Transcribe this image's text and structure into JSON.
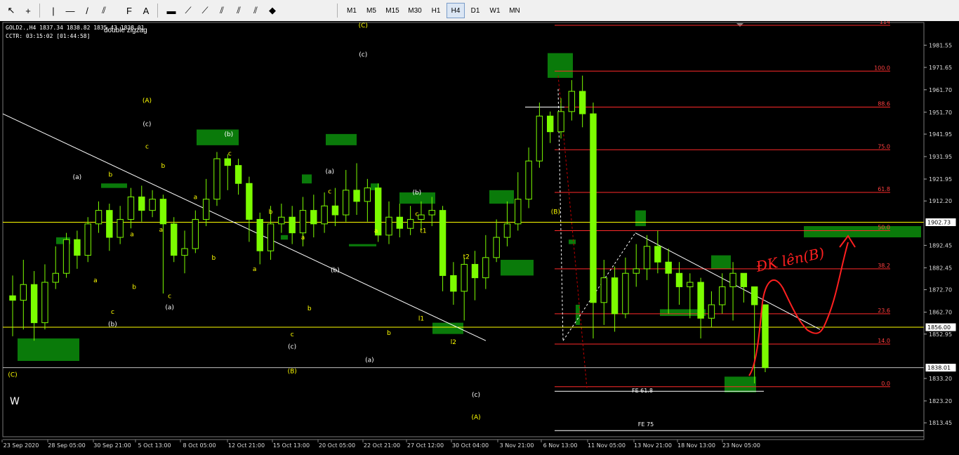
{
  "toolbar": {
    "timeframes": [
      "M1",
      "M5",
      "M15",
      "M30",
      "H1",
      "H4",
      "D1",
      "W1",
      "MN"
    ],
    "active_timeframe": "H4",
    "tools": [
      {
        "name": "cursor-icon",
        "glyph": "↖"
      },
      {
        "name": "crosshair-icon",
        "glyph": "+"
      },
      {
        "name": "vertical-line-icon",
        "glyph": "|"
      },
      {
        "name": "horizontal-line-icon",
        "glyph": "—"
      },
      {
        "name": "trendline-icon",
        "glyph": "/"
      },
      {
        "name": "equidistant-channel-icon",
        "glyph": "⫽"
      },
      {
        "name": "fibonacci-icon",
        "glyph": "F"
      },
      {
        "name": "text-icon",
        "glyph": "A"
      },
      {
        "name": "rectangle-icon",
        "glyph": "▬"
      },
      {
        "name": "fibo-fan-icon",
        "glyph": "⟋"
      },
      {
        "name": "fibo-arcs-icon",
        "glyph": "⟋"
      },
      {
        "name": "fibo-time-icon",
        "glyph": "⫽"
      },
      {
        "name": "gann-icon",
        "glyph": "⫽"
      },
      {
        "name": "pitchfork-icon",
        "glyph": "⫽"
      },
      {
        "name": "arrow-shapes-icon",
        "glyph": "◆"
      }
    ]
  },
  "chart_info": {
    "symbol_line": "GOLD2.,H4  1837.34 1838.82 1835.43 1838.01",
    "cctr_line": "CCTR: 03:15:02 [01:44:58]",
    "subtitle": "double zigzag",
    "wave_label_w": "W",
    "annotation_handwritten": "ĐK lên(B)"
  },
  "chart_data": {
    "type": "candlestick",
    "symbol": "GOLD2.",
    "timeframe": "H4",
    "ylim": [
      1808.5,
      1990.4
    ],
    "y_ticks": [
      1981.55,
      1971.65,
      1961.7,
      1951.7,
      1941.95,
      1931.95,
      1921.95,
      1912.2,
      1902.73,
      1892.45,
      1882.45,
      1872.7,
      1862.7,
      1856.0,
      1852.95,
      1838.01,
      1833.2,
      1823.2,
      1813.45
    ],
    "price_labels": [
      {
        "value": 1902.73,
        "text": "1902.73",
        "highlight": true
      },
      {
        "value": 1856.0,
        "text": "1856.00",
        "highlight": true
      },
      {
        "value": 1838.01,
        "text": "1838.01",
        "highlight": true
      }
    ],
    "x_labels": [
      "23 Sep 2020",
      "28 Sep 05:00",
      "30 Sep 21:00",
      "5 Oct 13:00",
      "8 Oct 05:00",
      "12 Oct 21:00",
      "15 Oct 13:00",
      "20 Oct 05:00",
      "22 Oct 21:00",
      "27 Oct 12:00",
      "30 Oct 04:00",
      "3 Nov 21:00",
      "6 Nov 13:00",
      "11 Nov 05:00",
      "13 Nov 21:00",
      "18 Nov 13:00",
      "23 Nov 05:00"
    ],
    "horizontal_lines": [
      {
        "value": 1902.73,
        "color": "#ffff00"
      },
      {
        "value": 1856.0,
        "color": "#ffff00"
      },
      {
        "value": 1838.01,
        "color": "#c0c0c0"
      }
    ],
    "fibonacci_levels": [
      {
        "label": "114",
        "value": 1990.4
      },
      {
        "label": "100.0",
        "value": 1970.0
      },
      {
        "label": "88.6",
        "value": 1954.0
      },
      {
        "label": "75.0",
        "value": 1935.0
      },
      {
        "label": "61.8",
        "value": 1916.0
      },
      {
        "label": "50.0",
        "value": 1899.0
      },
      {
        "label": "38.2",
        "value": 1882.0
      },
      {
        "label": "23.6",
        "value": 1862.0
      },
      {
        "label": "14.0",
        "value": 1848.5
      },
      {
        "label": "0.0",
        "value": 1829.5
      }
    ],
    "fibo_expansion_labels": [
      {
        "label": "FE 61.8",
        "value": 1827.5
      },
      {
        "label": "FE 75",
        "value": 1812.0
      }
    ],
    "wave_labels": [
      {
        "text": "(C)",
        "x": 0,
        "value": 1834.0,
        "color": "#ffff00"
      },
      {
        "text": "(a)",
        "x": 6.0,
        "value": 1922.0,
        "color": "#ffffff"
      },
      {
        "text": "b",
        "x": 9.1,
        "value": 1923.0,
        "color": "#ffff00"
      },
      {
        "text": "a",
        "x": 7.7,
        "value": 1876.0,
        "color": "#ffff00"
      },
      {
        "text": "c",
        "x": 9.3,
        "value": 1862.0,
        "color": "#ffff00"
      },
      {
        "text": "(b)",
        "x": 9.3,
        "value": 1856.5,
        "color": "#ffffff"
      },
      {
        "text": "b",
        "x": 11.3,
        "value": 1873.0,
        "color": "#ffff00"
      },
      {
        "text": "a",
        "x": 11.1,
        "value": 1896.5,
        "color": "#ffff00"
      },
      {
        "text": "(A)",
        "x": 12.5,
        "value": 1956.0,
        "color": "#ffff00"
      },
      {
        "text": "(c)",
        "x": 12.5,
        "value": 1945.5,
        "color": "#ffffff"
      },
      {
        "text": "c",
        "x": 12.5,
        "value": 1935.5,
        "color": "#ffff00"
      },
      {
        "text": "b",
        "x": 14.0,
        "value": 1927.0,
        "color": "#ffff00"
      },
      {
        "text": "a",
        "x": 13.8,
        "value": 1898.5,
        "color": "#ffff00"
      },
      {
        "text": "c",
        "x": 14.6,
        "value": 1869.0,
        "color": "#ffff00"
      },
      {
        "text": "(a)",
        "x": 14.6,
        "value": 1864.0,
        "color": "#ffffff"
      },
      {
        "text": "a",
        "x": 17.0,
        "value": 1913.0,
        "color": "#ffff00"
      },
      {
        "text": "b",
        "x": 18.7,
        "value": 1886.0,
        "color": "#ffff00"
      },
      {
        "text": "(b)",
        "x": 20.1,
        "value": 1941.0,
        "color": "#ffffff"
      },
      {
        "text": "c",
        "x": 20.2,
        "value": 1932.5,
        "color": "#ffff00"
      },
      {
        "text": "a",
        "x": 22.5,
        "value": 1881.0,
        "color": "#ffff00"
      },
      {
        "text": "b",
        "x": 24.0,
        "value": 1906.5,
        "color": "#ffff00"
      },
      {
        "text": "c",
        "x": 26.0,
        "value": 1852.0,
        "color": "#ffff00"
      },
      {
        "text": "(c)",
        "x": 26.0,
        "value": 1846.5,
        "color": "#ffffff"
      },
      {
        "text": "(B)",
        "x": 26.0,
        "value": 1835.5,
        "color": "#ffff00"
      },
      {
        "text": "a",
        "x": 27.0,
        "value": 1895.0,
        "color": "#ffff00"
      },
      {
        "text": "b",
        "x": 27.6,
        "value": 1863.5,
        "color": "#ffff00"
      },
      {
        "text": "(a)",
        "x": 29.5,
        "value": 1924.5,
        "color": "#ffffff"
      },
      {
        "text": "c",
        "x": 29.5,
        "value": 1915.5,
        "color": "#ffff00"
      },
      {
        "text": "(b)",
        "x": 30.0,
        "value": 1880.5,
        "color": "#ffffff"
      },
      {
        "text": "(C)",
        "x": 32.6,
        "value": 1989.5,
        "color": "#ffff00"
      },
      {
        "text": "(c)",
        "x": 32.6,
        "value": 1976.5,
        "color": "#ffffff"
      },
      {
        "text": "a",
        "x": 33.8,
        "value": 1898.0,
        "color": "#ffff00"
      },
      {
        "text": "b",
        "x": 35.0,
        "value": 1852.5,
        "color": "#ffff00"
      },
      {
        "text": "(a)",
        "x": 33.2,
        "value": 1840.5,
        "color": "#ffffff"
      },
      {
        "text": "(b)",
        "x": 37.6,
        "value": 1915.0,
        "color": "#ffffff"
      },
      {
        "text": "c",
        "x": 37.6,
        "value": 1905.5,
        "color": "#ffff00"
      },
      {
        "text": "t1",
        "x": 38.2,
        "value": 1898.0,
        "color": "#ffff00"
      },
      {
        "text": "l1",
        "x": 38.0,
        "value": 1859.0,
        "color": "#ffff00"
      },
      {
        "text": "t2",
        "x": 42.2,
        "value": 1886.5,
        "color": "#ffff00"
      },
      {
        "text": "l2",
        "x": 41.0,
        "value": 1848.5,
        "color": "#ffff00"
      },
      {
        "text": "(c)",
        "x": 43.1,
        "value": 1825.0,
        "color": "#ffffff"
      },
      {
        "text": "(A)",
        "x": 43.1,
        "value": 1815.0,
        "color": "#ffff00"
      },
      {
        "text": "(B)",
        "x": 50.5,
        "value": 1906.5,
        "color": "#ffff00"
      }
    ],
    "series": [
      {
        "name": "",
        "values": [
          [
            0,
            1870,
            1868,
            1879,
            1852
          ],
          [
            1,
            1868,
            1875,
            1886,
            1855
          ],
          [
            2,
            1875,
            1858,
            1881,
            1850
          ],
          [
            3,
            1858,
            1876,
            1884,
            1855
          ],
          [
            4,
            1876,
            1880,
            1892,
            1873
          ],
          [
            5,
            1880,
            1895,
            1898,
            1878
          ],
          [
            6,
            1895,
            1888,
            1899,
            1882
          ],
          [
            7,
            1888,
            1902,
            1905,
            1885
          ],
          [
            8,
            1902,
            1908,
            1912,
            1898
          ],
          [
            9,
            1908,
            1896,
            1911,
            1890
          ],
          [
            10,
            1896,
            1904,
            1910,
            1893
          ],
          [
            11,
            1904,
            1914,
            1918,
            1900
          ],
          [
            12,
            1914,
            1908,
            1919,
            1903
          ],
          [
            13,
            1908,
            1913,
            1917,
            1905
          ],
          [
            14,
            1913,
            1902,
            1915,
            1871
          ],
          [
            15,
            1902,
            1888,
            1905,
            1885
          ],
          [
            16,
            1888,
            1891,
            1899,
            1880
          ],
          [
            17,
            1891,
            1904,
            1908,
            1889
          ],
          [
            18,
            1904,
            1913,
            1922,
            1901
          ],
          [
            19,
            1913,
            1931,
            1934,
            1910
          ],
          [
            20,
            1931,
            1928,
            1933,
            1917
          ],
          [
            21,
            1928,
            1920,
            1931,
            1915
          ],
          [
            22,
            1920,
            1904,
            1923,
            1894
          ],
          [
            23,
            1904,
            1890,
            1907,
            1884
          ],
          [
            24,
            1890,
            1902,
            1910,
            1886
          ],
          [
            25,
            1902,
            1905,
            1911,
            1898
          ],
          [
            26,
            1905,
            1898,
            1910,
            1893
          ],
          [
            27,
            1898,
            1908,
            1914,
            1892
          ],
          [
            28,
            1908,
            1902,
            1915,
            1896
          ],
          [
            29,
            1902,
            1910,
            1916,
            1898
          ],
          [
            30,
            1910,
            1906,
            1918,
            1901
          ],
          [
            31,
            1906,
            1917,
            1926,
            1903
          ],
          [
            32,
            1917,
            1912,
            1929,
            1906
          ],
          [
            33,
            1912,
            1918,
            1922,
            1903
          ],
          [
            34,
            1918,
            1897,
            1920,
            1894
          ],
          [
            35,
            1897,
            1905,
            1912,
            1893
          ],
          [
            36,
            1905,
            1900,
            1911,
            1896
          ],
          [
            37,
            1900,
            1904,
            1910,
            1897
          ],
          [
            38,
            1904,
            1906,
            1912,
            1899
          ],
          [
            39,
            1906,
            1908,
            1914,
            1901
          ],
          [
            40,
            1908,
            1879,
            1910,
            1872
          ],
          [
            41,
            1879,
            1872,
            1885,
            1866
          ],
          [
            42,
            1872,
            1884,
            1887,
            1859
          ],
          [
            43,
            1884,
            1878,
            1890,
            1868
          ],
          [
            44,
            1878,
            1887,
            1897,
            1873
          ],
          [
            45,
            1887,
            1896,
            1904,
            1885
          ],
          [
            46,
            1896,
            1902,
            1912,
            1892
          ],
          [
            47,
            1902,
            1913,
            1925,
            1899
          ],
          [
            48,
            1913,
            1930,
            1936,
            1909
          ],
          [
            49,
            1930,
            1950,
            1956,
            1927
          ],
          [
            50,
            1950,
            1943,
            1952,
            1938
          ],
          [
            51,
            1943,
            1952,
            1958,
            1940
          ],
          [
            52,
            1952,
            1961,
            1966,
            1948
          ],
          [
            53,
            1961,
            1951,
            1968,
            1945
          ],
          [
            54,
            1951,
            1867,
            1956,
            1851
          ],
          [
            55,
            1867,
            1878,
            1886,
            1857
          ],
          [
            56,
            1878,
            1862,
            1883,
            1854
          ],
          [
            57,
            1862,
            1880,
            1887,
            1860
          ],
          [
            58,
            1880,
            1882,
            1893,
            1874
          ],
          [
            59,
            1882,
            1892,
            1897,
            1877
          ],
          [
            60,
            1892,
            1885,
            1899,
            1880
          ],
          [
            61,
            1885,
            1880,
            1891,
            1862
          ],
          [
            62,
            1880,
            1874,
            1885,
            1866
          ],
          [
            63,
            1874,
            1876,
            1880,
            1860
          ],
          [
            64,
            1876,
            1860,
            1878,
            1851
          ],
          [
            65,
            1860,
            1866,
            1872,
            1856
          ],
          [
            66,
            1866,
            1874,
            1880,
            1862
          ],
          [
            67,
            1874,
            1880,
            1885,
            1859
          ],
          [
            68,
            1880,
            1874,
            1879,
            1867
          ],
          [
            69,
            1874,
            1866,
            1870,
            1831
          ],
          [
            70,
            1866,
            1838,
            1844,
            1836
          ]
        ]
      }
    ]
  },
  "colors": {
    "background": "#000000",
    "bull_candle": "#7cfc00",
    "bear_candle": "#7cfc00",
    "fib_line": "#ff2a2a",
    "fib_text": "#ff4040",
    "trendline": "#ffffff",
    "horizontal_yellow": "#ffff00",
    "zone_fill": "#0a7a0a",
    "handwriting": "#ff2020"
  }
}
